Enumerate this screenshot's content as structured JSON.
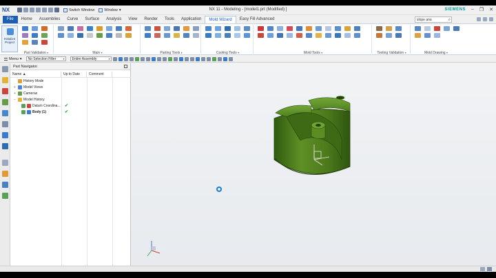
{
  "titlebar": {
    "logo": "NX",
    "switch_window_label": "Switch Window",
    "window_menu_label": "Window",
    "title": "NX 11 - Modeling - [model1.prt (Modified) ]",
    "brand": "SIEMENS"
  },
  "ribbon_tabs": [
    "File",
    "Home",
    "Assemblies",
    "Curve",
    "Surface",
    "Analysis",
    "View",
    "Render",
    "Tools",
    "Application",
    "Mold Wizard",
    "Easy Fill Advanced"
  ],
  "active_tab": "Mold Wizard",
  "search": {
    "value": "slope ana"
  },
  "ribbon": {
    "initialize_project_label": "Initialize Project",
    "groups": [
      "Part Validation",
      "Main",
      "Parting Tools",
      "Cooling Tools",
      "Mold Tools",
      "Tooling Validation",
      "Mold Drawing"
    ]
  },
  "selection_bar": {
    "menu_label": "Menu",
    "selection_filter": "No Selection Filter",
    "scope": "Entire Assembly"
  },
  "part_navigator": {
    "title": "Part Navigator",
    "columns": [
      "Name",
      "Up to Date",
      "Comment"
    ],
    "rows": [
      {
        "label": "History Mode",
        "uptodate": ""
      },
      {
        "label": "Model Views",
        "uptodate": ""
      },
      {
        "label": "Cameras",
        "uptodate": ""
      },
      {
        "label": "Model History",
        "uptodate": ""
      },
      {
        "label": "Datum Coordina...",
        "uptodate": "✔"
      },
      {
        "label": "Body (1)",
        "uptodate": "✔"
      }
    ]
  },
  "colors": {
    "model_green": "#4d7a1c",
    "accent_blue": "#1c5eb0",
    "brand_teal": "#009999"
  }
}
